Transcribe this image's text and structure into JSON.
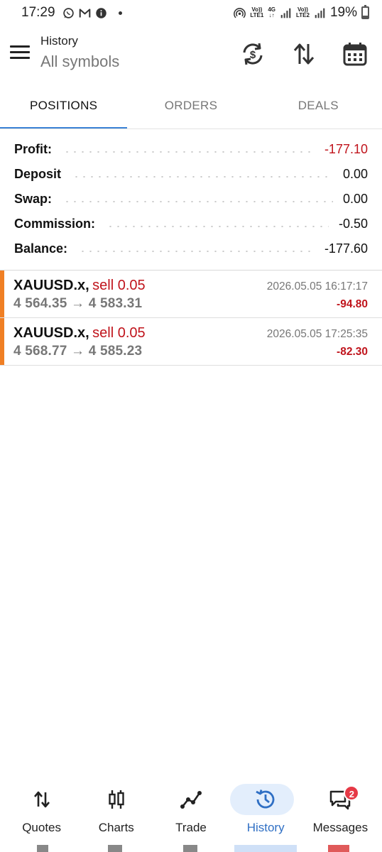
{
  "status_bar": {
    "time": "17:29",
    "battery": "19%",
    "battery_level": 0.19,
    "sim1_label": "LTE1",
    "sim2_label": "LTE2",
    "network_label": "4G",
    "left_icons": [
      "whatsapp-icon",
      "gmail-icon",
      "info-icon",
      "notification-dot"
    ],
    "right_icons": [
      "hotspot-icon",
      "volte-lte1-icon",
      "4g-data-icon",
      "signal-sim1-icon",
      "volte-lte2-icon",
      "signal-sim2-icon",
      "battery-icon"
    ]
  },
  "header": {
    "title": "History",
    "subtitle": "All symbols",
    "icons": [
      "menu-icon",
      "currency-exchange-icon",
      "sort-icon",
      "calendar-icon"
    ]
  },
  "tabs": [
    {
      "label": "POSITIONS",
      "active": true
    },
    {
      "label": "ORDERS",
      "active": false
    },
    {
      "label": "DEALS",
      "active": false
    }
  ],
  "summary": [
    {
      "label": "Profit:",
      "value": "-177.10"
    },
    {
      "label": "Deposit",
      "value": "0.00"
    },
    {
      "label": "Swap:",
      "value": "0.00"
    },
    {
      "label": "Commission:",
      "value": "-0.50"
    },
    {
      "label": "Balance:",
      "value": "-177.60"
    }
  ],
  "positions": [
    {
      "symbol": "XAUUSD.x,",
      "side": "sell 0.05",
      "time": "2026.05.05 16:17:17",
      "prices": "4 564.35 → 4 583.31",
      "profit": "-94.80"
    },
    {
      "symbol": "XAUUSD.x,",
      "side": "sell 0.05",
      "time": "2026.05.05 17:25:35",
      "prices": "4 568.77 → 4 585.23",
      "profit": "-82.30"
    }
  ],
  "bottom_nav": [
    {
      "label": "Quotes",
      "icon": "quotes-arrows-icon",
      "active": false
    },
    {
      "label": "Charts",
      "icon": "candlestick-icon",
      "active": false
    },
    {
      "label": "Trade",
      "icon": "trade-line-icon",
      "active": false
    },
    {
      "label": "History",
      "icon": "history-clock-icon",
      "active": true
    },
    {
      "label": "Messages",
      "icon": "messages-icon",
      "active": false,
      "badge": "2"
    }
  ],
  "colors": {
    "accent_blue": "#3b82d6",
    "negative_red": "#c0141c",
    "position_bar_orange": "#f07f24",
    "active_nav_bg": "#e3eefc",
    "badge_red": "#e63946"
  }
}
